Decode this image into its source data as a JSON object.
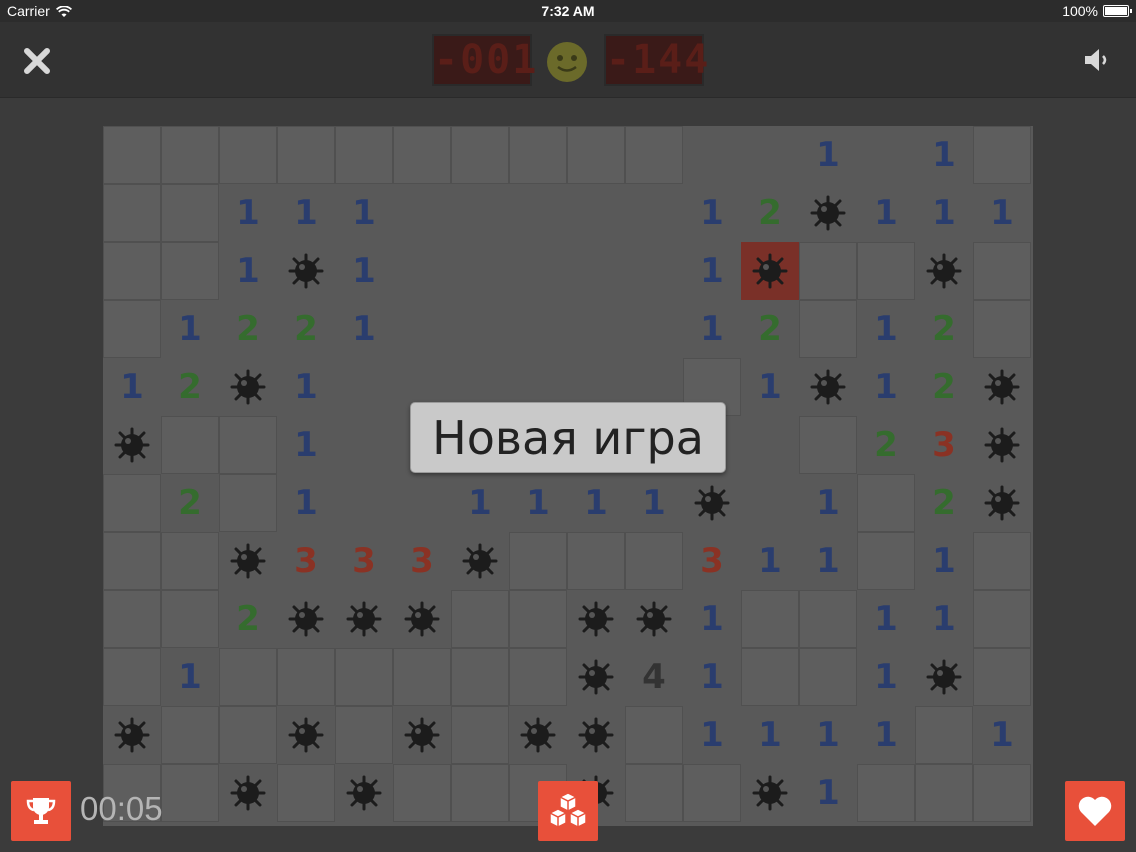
{
  "status_bar": {
    "carrier": "Carrier",
    "time": "7:32 AM",
    "battery": "100%"
  },
  "top_bar": {
    "close_icon": "close-icon",
    "sound_icon": "speaker-icon",
    "mines_counter": "-001",
    "timer_counter": "-144"
  },
  "dialog": {
    "new_game_label": "Новая игра"
  },
  "footer": {
    "elapsed_time": "00:05",
    "left_icon": "trophy-icon",
    "center_icon": "cubes-icon",
    "right_icon": "heart-icon"
  },
  "colors": {
    "accent": "#e8503a",
    "num1": "#2a3d6e",
    "num2": "#356c2e",
    "num3": "#8a3224",
    "num4": "#333333",
    "mine": "#1c1c1c"
  },
  "board": {
    "cols": 16,
    "rows": 12,
    "legend": "c=closed, e=empty, m=mine, x=exploded mine, 1-4=number",
    "grid": [
      "ccccccccccee1e1c",
      "cc111eeeee12m111",
      "cc1m1eeeee1xccmc",
      "c1221eeeee12c12c",
      "12m1eeeeeec1m12m",
      "mcc1eeeeeeeec23m",
      "c2c1ee1111me1c2m",
      "ccm333mccc311c1c",
      "cc2mmmccmm1cc11c",
      "c1ccccccm41cc1mc",
      "mccmcmcmmc1111c1",
      "ccmcmcccmccm1ccc"
    ]
  }
}
